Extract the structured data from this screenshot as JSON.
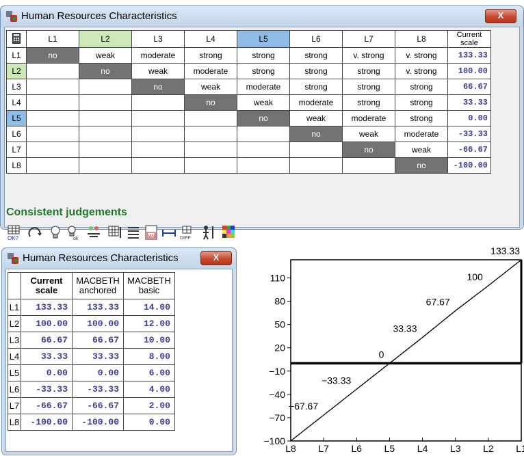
{
  "window1": {
    "title": "Human Resources Characteristics",
    "close_label": "X",
    "columns": [
      "L1",
      "L2",
      "L3",
      "L4",
      "L5",
      "L6",
      "L7",
      "L8"
    ],
    "current_scale_header": "Current scale",
    "rows": [
      {
        "label": "L1",
        "cells": [
          "no",
          "weak",
          "moderate",
          "strong",
          "strong",
          "strong",
          "v. strong",
          "v. strong"
        ],
        "scale": "133.33"
      },
      {
        "label": "L2",
        "cells": [
          "",
          "no",
          "weak",
          "moderate",
          "strong",
          "strong",
          "strong",
          "v. strong"
        ],
        "scale": "100.00"
      },
      {
        "label": "L3",
        "cells": [
          "",
          "",
          "no",
          "weak",
          "moderate",
          "strong",
          "strong",
          "strong"
        ],
        "scale": "66.67"
      },
      {
        "label": "L4",
        "cells": [
          "",
          "",
          "",
          "no",
          "weak",
          "moderate",
          "strong",
          "strong"
        ],
        "scale": "33.33"
      },
      {
        "label": "L5",
        "cells": [
          "",
          "",
          "",
          "",
          "no",
          "weak",
          "moderate",
          "strong"
        ],
        "scale": "0.00"
      },
      {
        "label": "L6",
        "cells": [
          "",
          "",
          "",
          "",
          "",
          "no",
          "weak",
          "moderate"
        ],
        "scale": "-33.33"
      },
      {
        "label": "L7",
        "cells": [
          "",
          "",
          "",
          "",
          "",
          "",
          "no",
          "weak"
        ],
        "scale": "-66.67"
      },
      {
        "label": "L8",
        "cells": [
          "",
          "",
          "",
          "",
          "",
          "",
          "",
          "no"
        ],
        "scale": "-100.00"
      }
    ],
    "status": "Consistent judgements",
    "highlight_colors": {
      "green": "#cde9b8",
      "blue": "#8fbce6",
      "diagonal": "#737373"
    },
    "toolbar_icons": [
      "ok-check-icon",
      "refresh-icon",
      "bulb-icon",
      "bulb-ok-icon",
      "people-compare-icon",
      "table-export-icon",
      "list-icon",
      "macbeth-icon",
      "interval-icon",
      "diff-icon",
      "person-chart-icon",
      "color-grid-icon"
    ]
  },
  "window2": {
    "title": "Human Resources Characteristics",
    "close_label": "X",
    "headers": [
      "Current scale",
      "MACBETH anchored",
      "MACBETH basic"
    ],
    "rows": [
      {
        "label": "L1",
        "current": "133.33",
        "anchored": "133.33",
        "basic": "14.00"
      },
      {
        "label": "L2",
        "current": "100.00",
        "anchored": "100.00",
        "basic": "12.00"
      },
      {
        "label": "L3",
        "current": "66.67",
        "anchored": "66.67",
        "basic": "10.00"
      },
      {
        "label": "L4",
        "current": "33.33",
        "anchored": "33.33",
        "basic": "8.00"
      },
      {
        "label": "L5",
        "current": "0.00",
        "anchored": "0.00",
        "basic": "6.00"
      },
      {
        "label": "L6",
        "current": "-33.33",
        "anchored": "-33.33",
        "basic": "4.00"
      },
      {
        "label": "L7",
        "current": "-66.67",
        "anchored": "-66.67",
        "basic": "2.00"
      },
      {
        "label": "L8",
        "current": "-100.00",
        "anchored": "-100.00",
        "basic": "0.00"
      }
    ]
  },
  "chart_data": {
    "type": "line",
    "categories": [
      "L8",
      "L7",
      "L6",
      "L5",
      "L4",
      "L3",
      "L2",
      "L1"
    ],
    "values": [
      -100,
      -66.67,
      -33.33,
      0,
      33.33,
      67.67,
      100,
      133.33
    ],
    "point_labels": [
      "",
      "−67.67",
      "−33.33",
      "0",
      "33.33",
      "67.67",
      "100",
      "133.33"
    ],
    "yticks": [
      110,
      80,
      50,
      20,
      -10,
      -40,
      -70,
      -100
    ],
    "ytick_labels": [
      "110",
      "80",
      "50",
      "20",
      "−10",
      "−40",
      "−70",
      "−100"
    ],
    "ylim": [
      -100,
      133.33
    ],
    "reference_line": 0,
    "grid": false
  }
}
